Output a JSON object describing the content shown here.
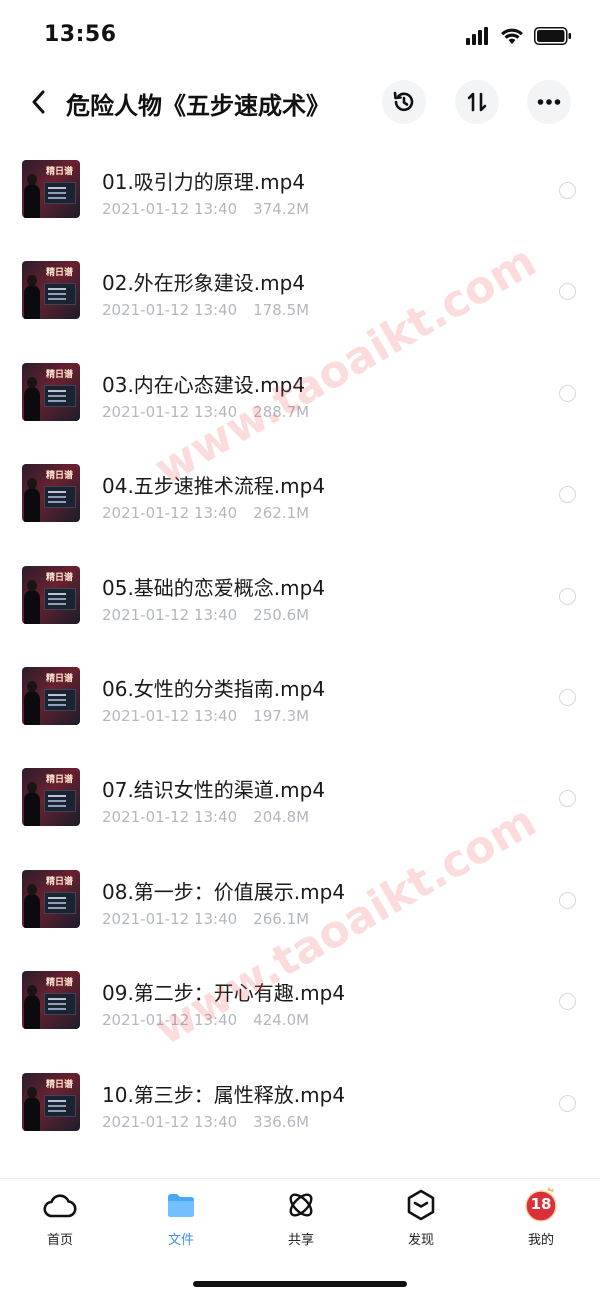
{
  "status_bar": {
    "time": "13:56"
  },
  "header": {
    "title": "危险人物《五步速成术》"
  },
  "files": [
    {
      "name": "01.吸引力的原理.mp4",
      "date": "2021-01-12 13:40",
      "size": "374.2M"
    },
    {
      "name": "02.外在形象建设.mp4",
      "date": "2021-01-12 13:40",
      "size": "178.5M"
    },
    {
      "name": "03.内在心态建设.mp4",
      "date": "2021-01-12 13:40",
      "size": "288.7M"
    },
    {
      "name": "04.五步速推术流程.mp4",
      "date": "2021-01-12 13:40",
      "size": "262.1M"
    },
    {
      "name": "05.基础的恋爱概念.mp4",
      "date": "2021-01-12 13:40",
      "size": "250.6M"
    },
    {
      "name": "06.女性的分类指南.mp4",
      "date": "2021-01-12 13:40",
      "size": "197.3M"
    },
    {
      "name": "07.结识女性的渠道.mp4",
      "date": "2021-01-12 13:40",
      "size": "204.8M"
    },
    {
      "name": "08.第一步：价值展示.mp4",
      "date": "2021-01-12 13:40",
      "size": "266.1M"
    },
    {
      "name": "09.第二步：开心有趣.mp4",
      "date": "2021-01-12 13:40",
      "size": "424.0M"
    },
    {
      "name": "10.第三步：属性释放.mp4",
      "date": "2021-01-12 13:40",
      "size": "336.6M"
    }
  ],
  "thumbnail_text": "精日谱",
  "watermark": "www.taoaikt.com",
  "tabs": [
    {
      "label": "首页",
      "icon": "cloud-icon"
    },
    {
      "label": "文件",
      "icon": "folder-icon",
      "active": true
    },
    {
      "label": "共享",
      "icon": "atom-icon"
    },
    {
      "label": "发现",
      "icon": "cube-icon"
    },
    {
      "label": "我的",
      "icon": "avatar-icon",
      "badge": "18"
    }
  ],
  "colors": {
    "accent": "#3e8ff7",
    "meta_text": "#b3b7bf",
    "watermark": "#eb5a5a"
  }
}
